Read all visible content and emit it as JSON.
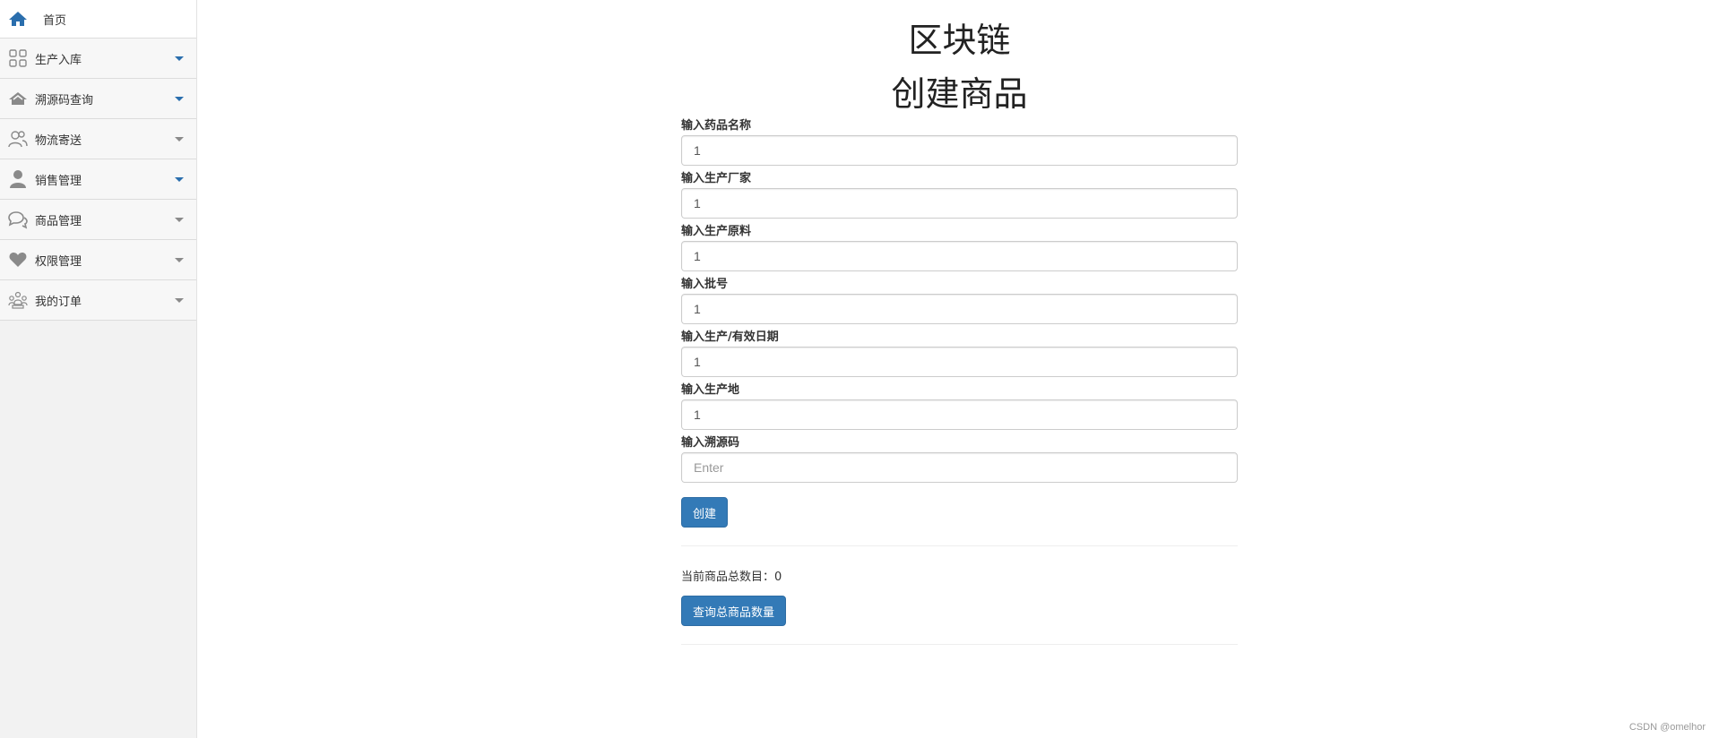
{
  "sidebar": {
    "items": [
      {
        "label": "首页",
        "icon": "home-icon",
        "caret": "none"
      },
      {
        "label": "生产入库",
        "icon": "grid-icon",
        "caret": "blue"
      },
      {
        "label": "溯源码查询",
        "icon": "house-outline-icon",
        "caret": "blue"
      },
      {
        "label": "物流寄送",
        "icon": "users-icon",
        "caret": "gray"
      },
      {
        "label": "销售管理",
        "icon": "user-icon",
        "caret": "blue"
      },
      {
        "label": "商品管理",
        "icon": "chat-icon",
        "caret": "gray"
      },
      {
        "label": "权限管理",
        "icon": "heart-icon",
        "caret": "gray"
      },
      {
        "label": "我的订单",
        "icon": "team-icon",
        "caret": "gray"
      }
    ]
  },
  "main": {
    "title": "区块链",
    "subtitle": "创建商品",
    "fields": [
      {
        "label": "输入药品名称",
        "value": "1",
        "placeholder": ""
      },
      {
        "label": "输入生产厂家",
        "value": "1",
        "placeholder": ""
      },
      {
        "label": "输入生产原料",
        "value": "1",
        "placeholder": ""
      },
      {
        "label": "输入批号",
        "value": "1",
        "placeholder": ""
      },
      {
        "label": "输入生产/有效日期",
        "value": "1",
        "placeholder": ""
      },
      {
        "label": "输入生产地",
        "value": "1",
        "placeholder": ""
      },
      {
        "label": "输入溯源码",
        "value": "",
        "placeholder": "Enter"
      }
    ],
    "create_button": "创建",
    "count_label": "当前商品总数目：",
    "count_value": "0",
    "query_button": "查询总商品数量"
  },
  "watermark": "CSDN @omelhor",
  "colors": {
    "primary": "#337ab7",
    "caret_blue": "#2a6ead",
    "sidebar_bg": "#f2f2f2"
  }
}
